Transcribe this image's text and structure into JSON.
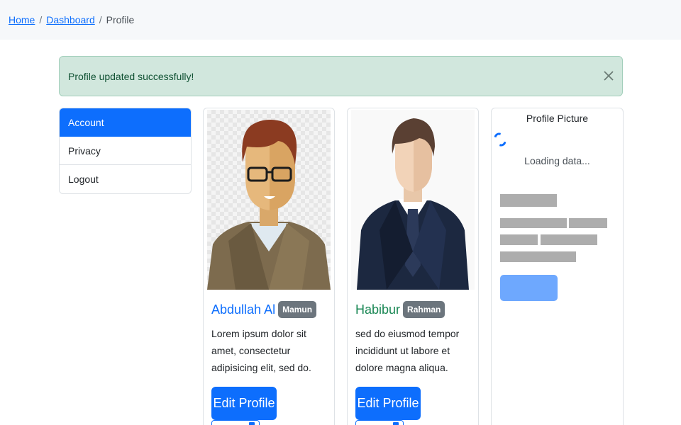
{
  "breadcrumb": {
    "items": [
      {
        "label": "Home"
      },
      {
        "label": "Dashboard"
      }
    ],
    "current": "Profile",
    "separator": "/"
  },
  "alert": {
    "message": "Profile updated successfully!",
    "close_icon": "close-icon"
  },
  "sidebar": {
    "items": [
      {
        "label": "Account",
        "active": true
      },
      {
        "label": "Privacy",
        "active": false
      },
      {
        "label": "Logout",
        "active": false
      }
    ]
  },
  "cards": [
    {
      "first_name": "Abdullah Al",
      "badge": "Mamun",
      "text": "Lorem ipsum dolor sit amet, consectetur adipisicing elit, sed do.",
      "button": "Edit Profile",
      "name_color": "#0d6efd"
    },
    {
      "first_name": "Habibur",
      "badge": "Rahman",
      "text": "sed do eiusmod tempor incididunt ut labore et dolore magna aliqua.",
      "button": "Edit Profile",
      "name_color": "#198754"
    }
  ],
  "profile_picture": {
    "title": "Profile Picture",
    "loading_text": "Loading data..."
  },
  "colors": {
    "primary": "#0d6efd",
    "success_bg": "#d1e7dd",
    "success_text": "#0f5132",
    "badge": "#6c757d",
    "placeholder": "#adadad"
  }
}
